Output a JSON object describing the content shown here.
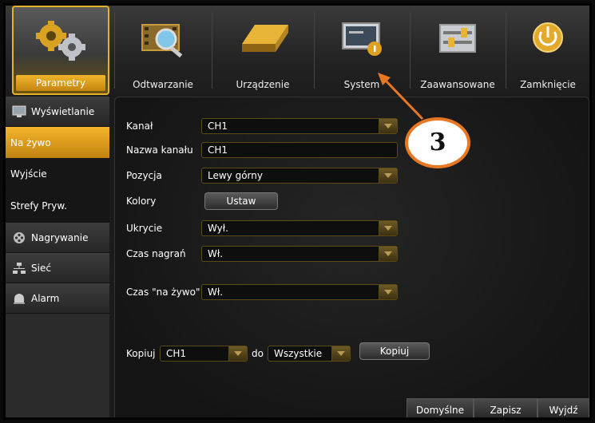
{
  "top_menu": [
    {
      "label": "Parametry",
      "icon": "gears-icon",
      "active": true
    },
    {
      "label": "Odtwarzanie",
      "icon": "film-magnifier-icon",
      "active": false
    },
    {
      "label": "Urządzenie",
      "icon": "hard-drive-icon",
      "active": false
    },
    {
      "label": "System",
      "icon": "monitor-info-icon",
      "active": false
    },
    {
      "label": "Zaawansowane",
      "icon": "sliders-icon",
      "active": false
    },
    {
      "label": "Zamknięcie",
      "icon": "power-icon",
      "active": false
    }
  ],
  "sidebar": [
    {
      "label": "Wyświetlanie",
      "icon": "monitor-icon"
    },
    {
      "label": "Na żywo",
      "active": true
    },
    {
      "label": "Wyjście"
    },
    {
      "label": "Strefy Pryw."
    },
    {
      "label": "Nagrywanie",
      "icon": "film-reel-icon"
    },
    {
      "label": "Sieć",
      "icon": "network-icon"
    },
    {
      "label": "Alarm",
      "icon": "alarm-icon"
    }
  ],
  "form": {
    "kanal_label": "Kanał",
    "kanal_value": "CH1",
    "nazwa_label": "Nazwa kanału",
    "nazwa_value": "CH1",
    "pozycja_label": "Pozycja",
    "pozycja_value": "Lewy górny",
    "kolory_label": "Kolory",
    "kolory_button": "Ustaw",
    "ukrycie_label": "Ukrycie",
    "ukrycie_value": "Wył.",
    "czas_nagran_label": "Czas nagrań",
    "czas_nagran_value": "Wł.",
    "czas_zywo_label": "Czas \"na żywo\"",
    "czas_zywo_value": "Wł.",
    "kopiuj_label": "Kopiuj",
    "kopiuj_from": "CH1",
    "do_label": "do",
    "kopiuj_to": "Wszystkie",
    "kopiuj_button": "Kopiuj"
  },
  "footer": {
    "defaults": "Domyślne",
    "save": "Zapisz",
    "exit": "Wyjdź"
  },
  "annotation": {
    "number": "3",
    "color": "#e87722"
  },
  "colors": {
    "accent": "#e3b12a",
    "active_bg": "#f1b52a"
  }
}
